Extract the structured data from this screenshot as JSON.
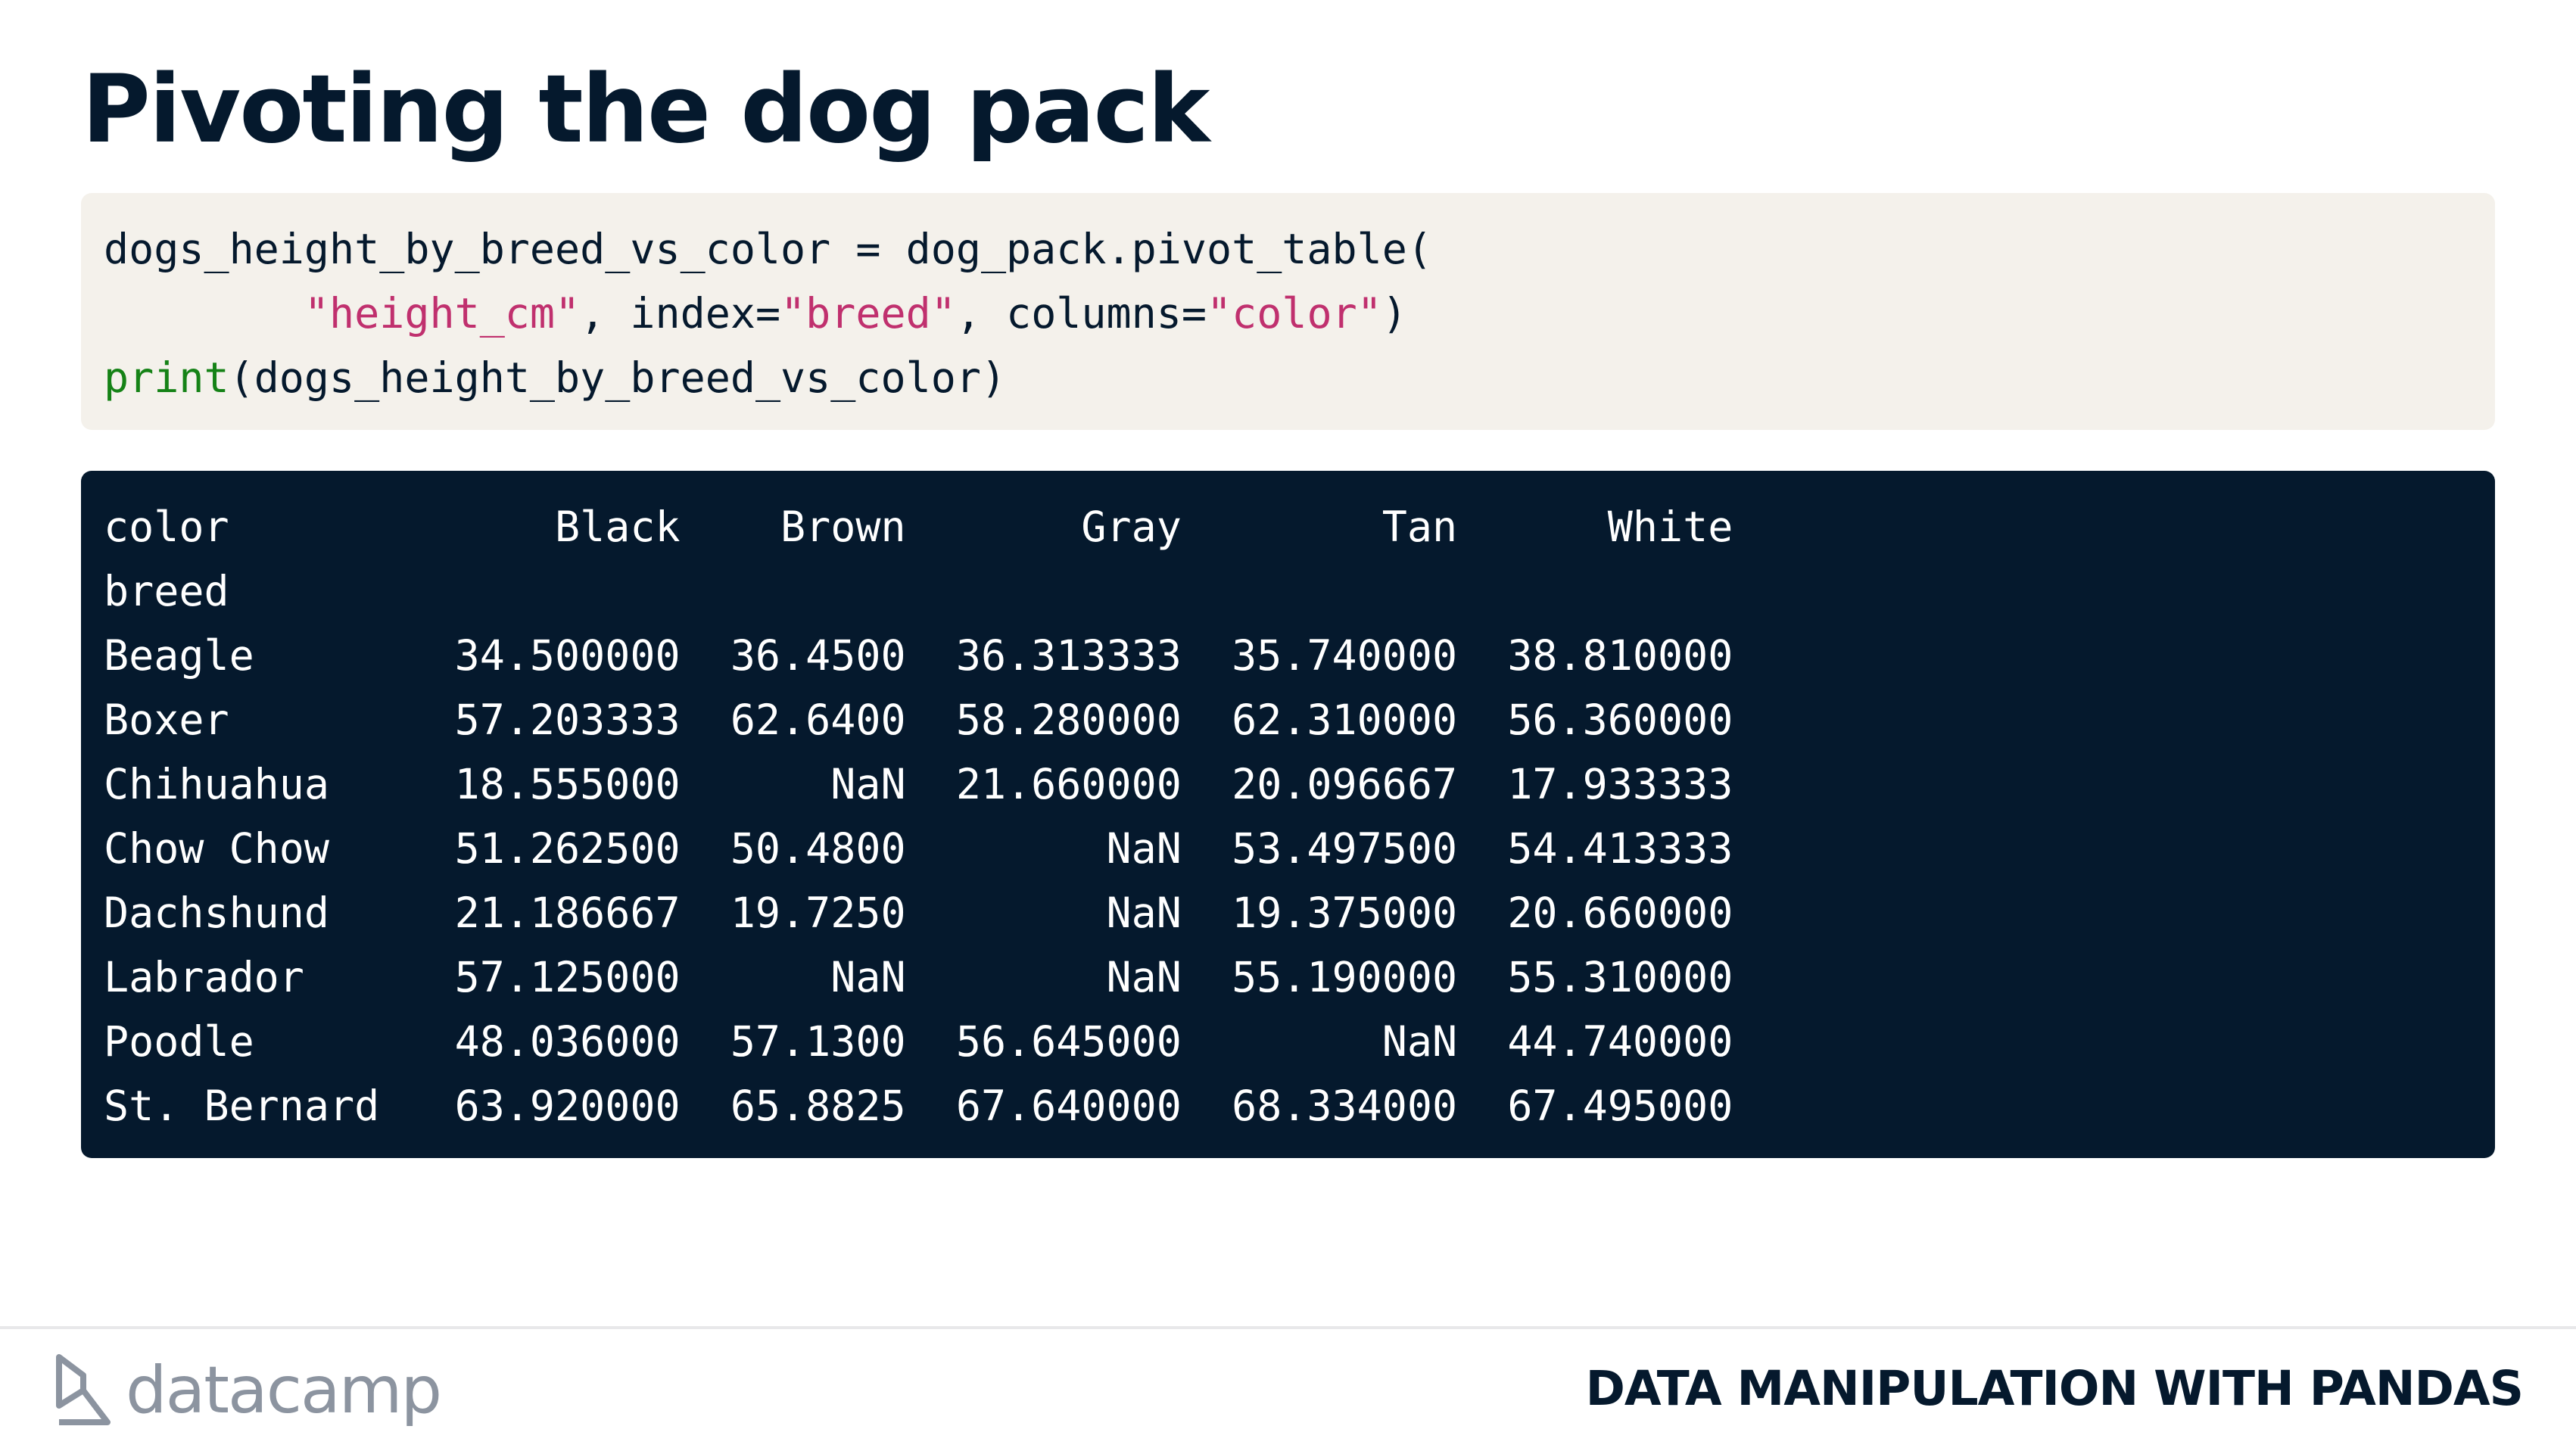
{
  "slide": {
    "title": "Pivoting the dog pack"
  },
  "code": {
    "line1": "dogs_height_by_breed_vs_color = dog_pack.pivot_table(",
    "line2_indent": "        ",
    "line2_arg1": "\"height_cm\"",
    "line2_mid1": ", index=",
    "line2_arg2": "\"breed\"",
    "line2_mid2": ", columns=",
    "line2_arg3": "\"color\"",
    "line2_end": ")",
    "line3_fn": "print",
    "line3_rest": "(dogs_height_by_breed_vs_color)"
  },
  "output": {
    "lines": [
      "color             Black    Brown       Gray        Tan      White",
      "breed",
      "Beagle        34.500000  36.4500  36.313333  35.740000  38.810000",
      "Boxer         57.203333  62.6400  58.280000  62.310000  56.360000",
      "Chihuahua     18.555000      NaN  21.660000  20.096667  17.933333",
      "Chow Chow     51.262500  50.4800        NaN  53.497500  54.413333",
      "Dachshund     21.186667  19.7250        NaN  19.375000  20.660000",
      "Labrador      57.125000      NaN        NaN  55.190000  55.310000",
      "Poodle        48.036000  57.1300  56.645000        NaN  44.740000",
      "St. Bernard   63.920000  65.8825  67.640000  68.334000  67.495000"
    ]
  },
  "footer": {
    "brand": "datacamp",
    "course": "DATA MANIPULATION WITH PANDAS"
  },
  "colors": {
    "navy": "#05192d",
    "code_bg": "#f4f1eb",
    "string": "#c0306e",
    "builtin": "#158216",
    "logo_gray": "#8c94a0"
  }
}
